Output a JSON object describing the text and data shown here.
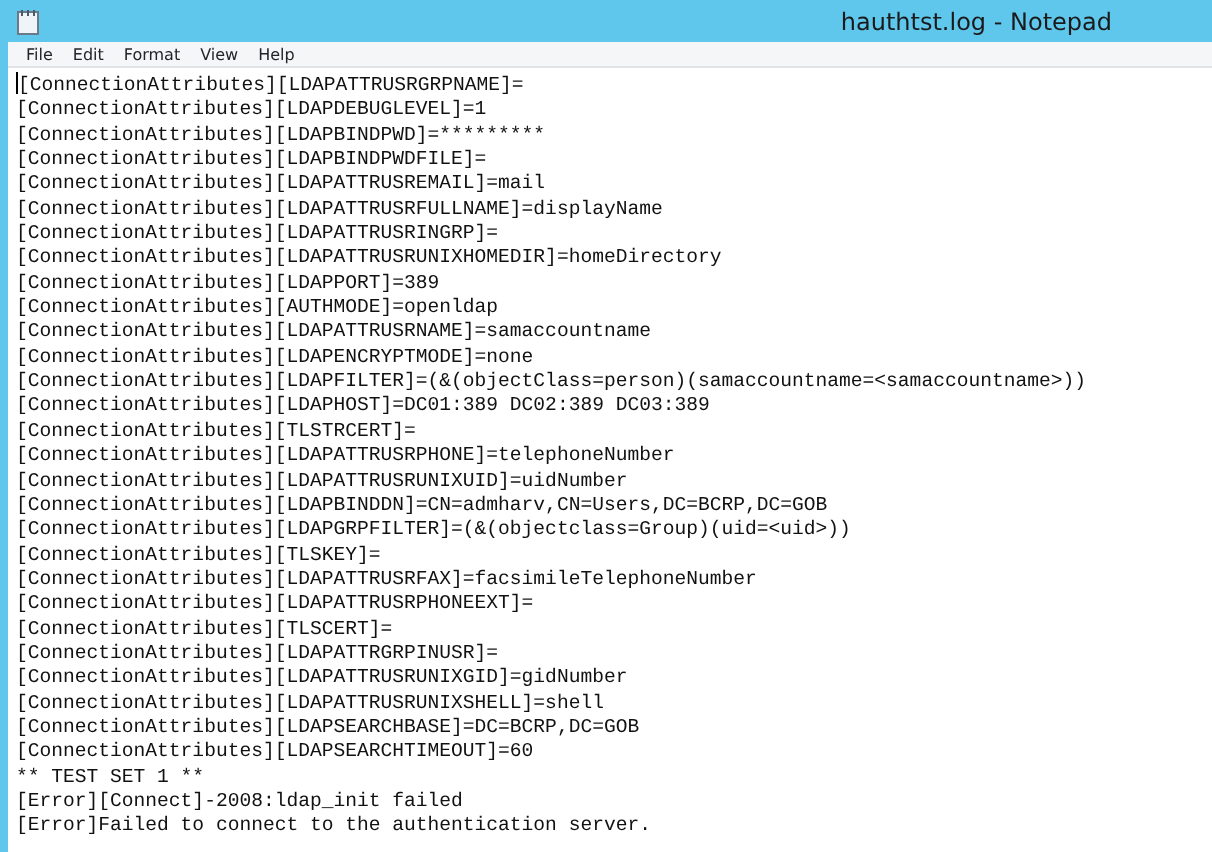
{
  "window": {
    "title": "hauthtst.log - Notepad"
  },
  "menu": [
    "File",
    "Edit",
    "Format",
    "View",
    "Help"
  ],
  "lines": [
    "[ConnectionAttributes][LDAPATTRUSRGRPNAME]=",
    "[ConnectionAttributes][LDAPDEBUGLEVEL]=1",
    "[ConnectionAttributes][LDAPBINDPWD]=*********",
    "[ConnectionAttributes][LDAPBINDPWDFILE]=",
    "[ConnectionAttributes][LDAPATTRUSREMAIL]=mail",
    "[ConnectionAttributes][LDAPATTRUSRFULLNAME]=displayName",
    "[ConnectionAttributes][LDAPATTRUSRINGRP]=",
    "[ConnectionAttributes][LDAPATTRUSRUNIXHOMEDIR]=homeDirectory",
    "[ConnectionAttributes][LDAPPORT]=389",
    "[ConnectionAttributes][AUTHMODE]=openldap",
    "[ConnectionAttributes][LDAPATTRUSRNAME]=samaccountname",
    "[ConnectionAttributes][LDAPENCRYPTMODE]=none",
    "[ConnectionAttributes][LDAPFILTER]=(&(objectClass=person)(samaccountname=<samaccountname>))",
    "[ConnectionAttributes][LDAPHOST]=DC01:389 DC02:389 DC03:389",
    "[ConnectionAttributes][TLSTRCERT]=",
    "[ConnectionAttributes][LDAPATTRUSRPHONE]=telephoneNumber",
    "[ConnectionAttributes][LDAPATTRUSRUNIXUID]=uidNumber",
    "[ConnectionAttributes][LDAPBINDDN]=CN=admharv,CN=Users,DC=BCRP,DC=GOB",
    "[ConnectionAttributes][LDAPGRPFILTER]=(&(objectclass=Group)(uid=<uid>))",
    "[ConnectionAttributes][TLSKEY]=",
    "[ConnectionAttributes][LDAPATTRUSRFAX]=facsimileTelephoneNumber",
    "[ConnectionAttributes][LDAPATTRUSRPHONEEXT]=",
    "[ConnectionAttributes][TLSCERT]=",
    "[ConnectionAttributes][LDAPATTRGRPINUSR]=",
    "[ConnectionAttributes][LDAPATTRUSRUNIXGID]=gidNumber",
    "[ConnectionAttributes][LDAPATTRUSRUNIXSHELL]=shell",
    "[ConnectionAttributes][LDAPSEARCHBASE]=DC=BCRP,DC=GOB",
    "[ConnectionAttributes][LDAPSEARCHTIMEOUT]=60",
    "** TEST SET 1 **",
    "[Error][Connect]-2008:ldap_init failed",
    "[Error]Failed to connect to the authentication server."
  ]
}
